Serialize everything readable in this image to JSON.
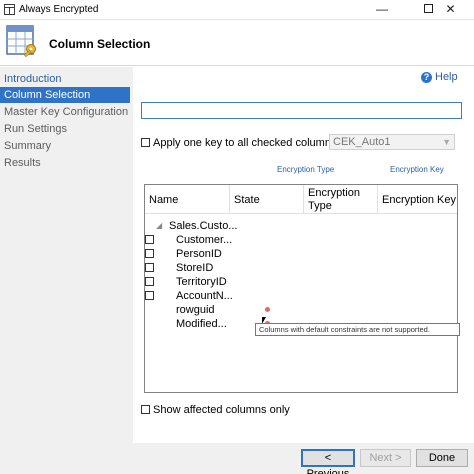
{
  "window": {
    "title": "Always Encrypted",
    "minimize_glyph": "—",
    "close_glyph": "✕"
  },
  "header": {
    "title": "Column Selection",
    "icon": "table-key-icon"
  },
  "sidebar": {
    "items": [
      {
        "label": "Introduction",
        "state": "link"
      },
      {
        "label": "Column Selection",
        "state": "active"
      },
      {
        "label": "Master Key Configuration",
        "state": "inactive"
      },
      {
        "label": "Run Settings",
        "state": "inactive"
      },
      {
        "label": "Summary",
        "state": "inactive"
      },
      {
        "label": "Results",
        "state": "inactive"
      }
    ]
  },
  "content": {
    "help_label": "Help",
    "search_value": "",
    "apply_one_key_label": "Apply one key to all checked columns:",
    "key_select_value": "CEK_Auto1",
    "col_link_type": "Encryption Type",
    "col_link_key": "Encryption Key",
    "grid": {
      "headers": {
        "name": "Name",
        "state": "State",
        "encryption_type": "Encryption Type",
        "encryption_key": "Encryption Key"
      },
      "table_node": "Sales.Custo...",
      "rows": [
        {
          "name": "Customer...",
          "has_checkbox": true,
          "has_state_icon": false
        },
        {
          "name": "PersonID",
          "has_checkbox": true,
          "has_state_icon": false
        },
        {
          "name": "StoreID",
          "has_checkbox": true,
          "has_state_icon": false
        },
        {
          "name": "TerritoryID",
          "has_checkbox": true,
          "has_state_icon": false
        },
        {
          "name": "AccountN...",
          "has_checkbox": true,
          "has_state_icon": false
        },
        {
          "name": "rowguid",
          "has_checkbox": false,
          "has_state_icon": true
        },
        {
          "name": "Modified...",
          "has_checkbox": false,
          "has_state_icon": true
        }
      ]
    },
    "tooltip": "Columns with default constraints are not supported.",
    "show_affected_label": "Show affected columns only"
  },
  "footer": {
    "previous_label": "< Previous",
    "next_label": "Next >",
    "done_label": "Done"
  },
  "colors": {
    "accent": "#2f73c9",
    "link": "#2a5fa8",
    "warning": "#e06a6a"
  }
}
